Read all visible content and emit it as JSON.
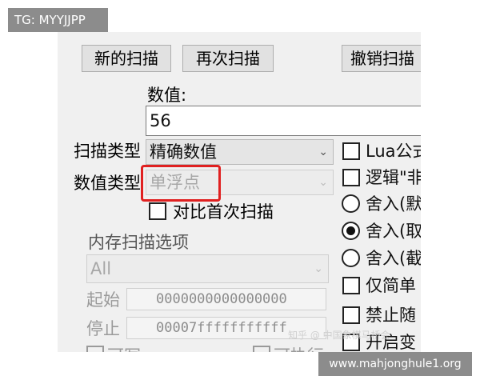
{
  "overlays": {
    "top_tag": "TG: MYYJJPP",
    "bottom_tag": "www.mahjonghule1.org",
    "watermark": "知乎 @ 中国象棋马桥会"
  },
  "toolbar": {
    "new_scan_label": "新的扫描",
    "next_scan_label": "再次扫描",
    "undo_scan_label": "撤销扫描"
  },
  "value": {
    "label": "数值:",
    "current": "56"
  },
  "scan_type": {
    "label": "扫描类型",
    "selected": "精确数值"
  },
  "value_type": {
    "label": "数值类型",
    "selected": "单浮点"
  },
  "compare_first": {
    "label": "对比首次扫描",
    "checked": false
  },
  "memory_options": {
    "title": "内存扫描选项",
    "region": "All",
    "start_label": "起始",
    "start_value": "0000000000000000",
    "stop_label": "停止",
    "stop_value": "00007fffffffffff",
    "writable_label": "可写",
    "executable_label": "可执行"
  },
  "right_options": {
    "lua_formula": "Lua公式",
    "logic_not": "逻辑\"非",
    "round_default": "舍入(默",
    "round_extreme": "舍入(取",
    "round_truncate": "舍入(截",
    "simple_only": "仅简单",
    "no_random": "禁止随",
    "enable_speed": "开启变"
  }
}
